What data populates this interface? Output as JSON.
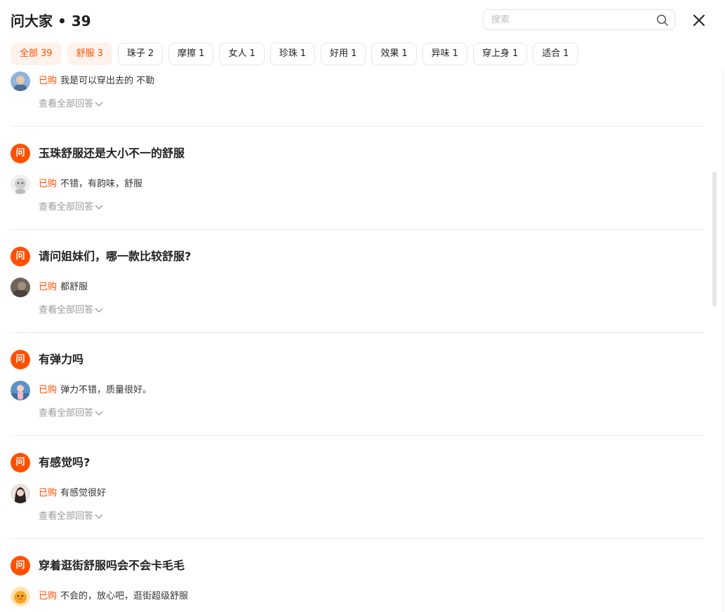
{
  "header": {
    "title": "问大家 • 39",
    "search_placeholder": "搜索"
  },
  "tags": [
    {
      "label": "全部",
      "count": "39",
      "active": true
    },
    {
      "label": "舒服",
      "count": "3",
      "active": true
    },
    {
      "label": "珠子",
      "count": "2",
      "active": false
    },
    {
      "label": "摩擦",
      "count": "1",
      "active": false
    },
    {
      "label": "女人",
      "count": "1",
      "active": false
    },
    {
      "label": "珍珠",
      "count": "1",
      "active": false
    },
    {
      "label": "好用",
      "count": "1",
      "active": false
    },
    {
      "label": "效果",
      "count": "1",
      "active": false
    },
    {
      "label": "异味",
      "count": "1",
      "active": false
    },
    {
      "label": "穿上身",
      "count": "1",
      "active": false
    },
    {
      "label": "适合",
      "count": "1",
      "active": false
    }
  ],
  "questions": [
    {
      "badge": "问",
      "question": "",
      "bought": "已购",
      "answer": "我是可以穿出去的 不勒",
      "more": "查看全部回答",
      "avatar_color": "#7fa7d4"
    },
    {
      "badge": "问",
      "question": "玉珠舒服还是大小不一的舒服",
      "bought": "已购",
      "answer": "不错，有韵味，舒服",
      "more": "查看全部回答",
      "avatar_color": "#d9d9d9"
    },
    {
      "badge": "问",
      "question": "请问姐妹们，哪一款比较舒服?",
      "bought": "已购",
      "answer": "都舒服",
      "more": "查看全部回答",
      "avatar_color": "#6e6458"
    },
    {
      "badge": "问",
      "question": "有弹力吗",
      "bought": "已购",
      "answer": "弹力不错，质量很好。",
      "more": "查看全部回答",
      "avatar_color": "#4f86b8"
    },
    {
      "badge": "问",
      "question": "有感觉吗?",
      "bought": "已购",
      "answer": "有感觉很好",
      "more": "查看全部回答",
      "avatar_color": "#3a3330"
    },
    {
      "badge": "问",
      "question": "穿着逛街舒服吗会不会卡毛毛",
      "bought": "已购",
      "answer": "不会的，放心吧，逛街超级舒服",
      "more": "查看全部回答",
      "avatar_color": "#f5a623"
    }
  ]
}
